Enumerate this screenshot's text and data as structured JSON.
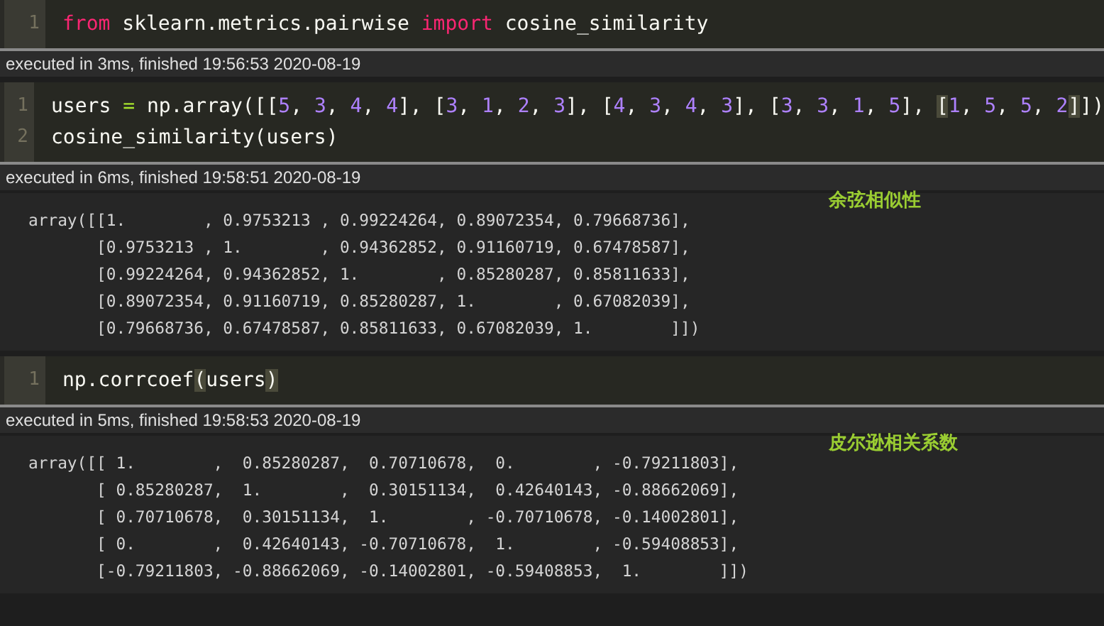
{
  "cells": [
    {
      "code_lines": [
        {
          "number": "1",
          "tokens": [
            {
              "kind": "keyword",
              "text": "from"
            },
            {
              "kind": "plain",
              "text": " sklearn.metrics.pairwise "
            },
            {
              "kind": "keyword",
              "text": "import"
            },
            {
              "kind": "plain",
              "text": " cosine_similarity"
            }
          ]
        }
      ],
      "status": "executed in 3ms, finished 19:56:53 2020-08-19"
    },
    {
      "code_lines": [
        {
          "number": "1",
          "tokens": [
            {
              "kind": "plain",
              "text": "users "
            },
            {
              "kind": "operator",
              "text": "="
            },
            {
              "kind": "plain",
              "text": " np.array([["
            },
            {
              "kind": "number",
              "text": "5"
            },
            {
              "kind": "plain",
              "text": ", "
            },
            {
              "kind": "number",
              "text": "3"
            },
            {
              "kind": "plain",
              "text": ", "
            },
            {
              "kind": "number",
              "text": "4"
            },
            {
              "kind": "plain",
              "text": ", "
            },
            {
              "kind": "number",
              "text": "4"
            },
            {
              "kind": "plain",
              "text": "], ["
            },
            {
              "kind": "number",
              "text": "3"
            },
            {
              "kind": "plain",
              "text": ", "
            },
            {
              "kind": "number",
              "text": "1"
            },
            {
              "kind": "plain",
              "text": ", "
            },
            {
              "kind": "number",
              "text": "2"
            },
            {
              "kind": "plain",
              "text": ", "
            },
            {
              "kind": "number",
              "text": "3"
            },
            {
              "kind": "plain",
              "text": "], ["
            },
            {
              "kind": "number",
              "text": "4"
            },
            {
              "kind": "plain",
              "text": ", "
            },
            {
              "kind": "number",
              "text": "3"
            },
            {
              "kind": "plain",
              "text": ", "
            },
            {
              "kind": "number",
              "text": "4"
            },
            {
              "kind": "plain",
              "text": ", "
            },
            {
              "kind": "number",
              "text": "3"
            },
            {
              "kind": "plain",
              "text": "], ["
            },
            {
              "kind": "number",
              "text": "3"
            },
            {
              "kind": "plain",
              "text": ", "
            },
            {
              "kind": "number",
              "text": "3"
            },
            {
              "kind": "plain",
              "text": ", "
            },
            {
              "kind": "number",
              "text": "1"
            },
            {
              "kind": "plain",
              "text": ", "
            },
            {
              "kind": "number",
              "text": "5"
            },
            {
              "kind": "plain",
              "text": "], "
            },
            {
              "kind": "match",
              "text": "["
            },
            {
              "kind": "number",
              "text": "1"
            },
            {
              "kind": "plain",
              "text": ", "
            },
            {
              "kind": "number",
              "text": "5"
            },
            {
              "kind": "plain",
              "text": ", "
            },
            {
              "kind": "number",
              "text": "5"
            },
            {
              "kind": "plain",
              "text": ", "
            },
            {
              "kind": "number",
              "text": "2"
            },
            {
              "kind": "match",
              "text": "]"
            },
            {
              "kind": "plain",
              "text": "])"
            }
          ]
        },
        {
          "number": "2",
          "tokens": [
            {
              "kind": "plain",
              "text": "cosine_similarity(users)"
            }
          ]
        }
      ],
      "status": "executed in 6ms, finished 19:58:51 2020-08-19",
      "output": {
        "annotation": "余弦相似性",
        "lines": [
          "array([[1.        , 0.9753213 , 0.99224264, 0.89072354, 0.79668736],",
          "       [0.9753213 , 1.        , 0.94362852, 0.91160719, 0.67478587],",
          "       [0.99224264, 0.94362852, 1.        , 0.85280287, 0.85811633],",
          "       [0.89072354, 0.91160719, 0.85280287, 1.        , 0.67082039],",
          "       [0.79668736, 0.67478587, 0.85811633, 0.67082039, 1.        ]])"
        ]
      }
    },
    {
      "code_lines": [
        {
          "number": "1",
          "tokens": [
            {
              "kind": "plain",
              "text": "np.corrcoef"
            },
            {
              "kind": "match",
              "text": "("
            },
            {
              "kind": "plain",
              "text": "users"
            },
            {
              "kind": "match",
              "text": ")"
            }
          ]
        }
      ],
      "status": "executed in 5ms, finished 19:58:53 2020-08-19",
      "output": {
        "annotation": "皮尔逊相关系数",
        "lines": [
          "array([[ 1.        ,  0.85280287,  0.70710678,  0.        , -0.79211803],",
          "       [ 0.85280287,  1.        ,  0.30151134,  0.42640143, -0.88662069],",
          "       [ 0.70710678,  0.30151134,  1.        , -0.70710678, -0.14002801],",
          "       [ 0.        ,  0.42640143, -0.70710678,  1.        , -0.59408853],",
          "       [-0.79211803, -0.88662069, -0.14002801, -0.59408853,  1.        ]])"
        ]
      }
    }
  ]
}
